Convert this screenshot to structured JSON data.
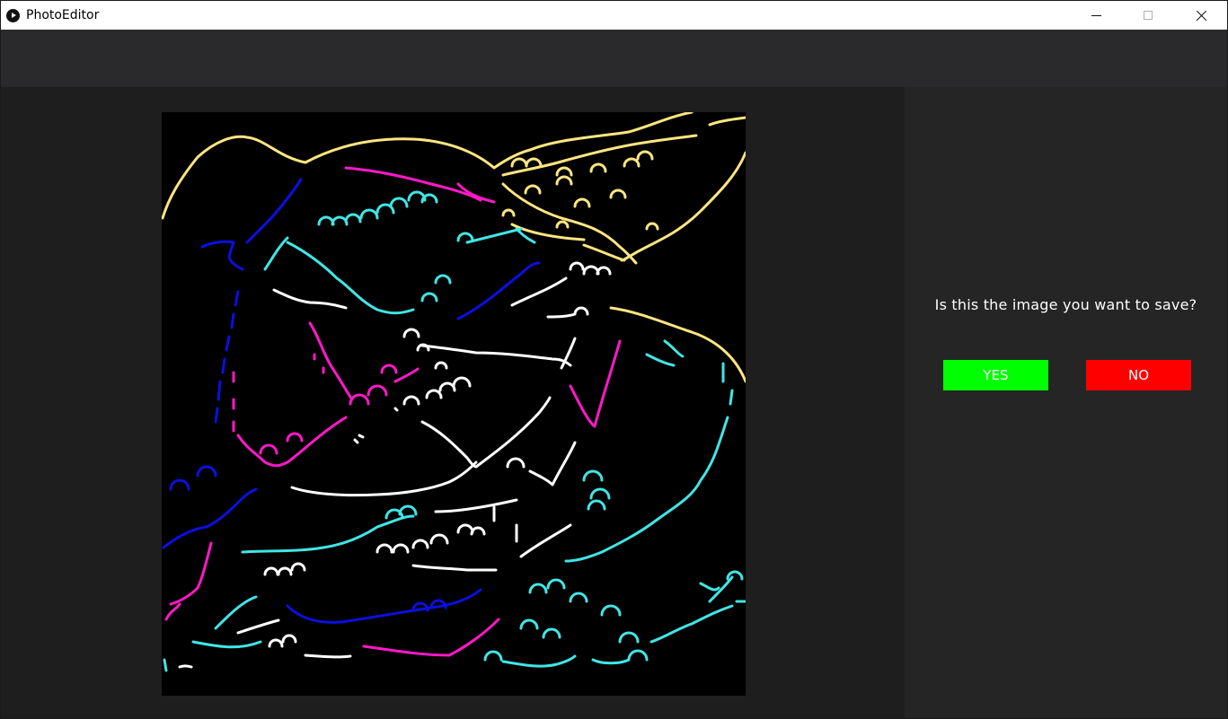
{
  "window": {
    "title": "PhotoEditor",
    "app_icon": "play-circle-icon",
    "controls": [
      "minimize-icon",
      "maximize-icon",
      "close-icon"
    ]
  },
  "dialog": {
    "prompt": "Is this the image you want to save?",
    "yes_label": "YES",
    "no_label": "NO"
  },
  "colors": {
    "yes": "#00ff00",
    "no": "#ff0000",
    "image_background": "#000000",
    "edge_yellow": "#ffe680",
    "edge_magenta": "#ff19c8",
    "edge_blue": "#0a10e0",
    "edge_cyan": "#40e6e6",
    "edge_white": "#ffffff"
  }
}
